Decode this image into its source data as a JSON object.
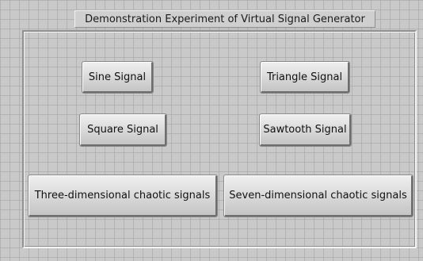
{
  "window": {
    "title": "Demonstration Experiment of Virtual Signal Generator"
  },
  "buttons": {
    "sine": "Sine Signal",
    "triangle": "Triangle Signal",
    "square": "Square Signal",
    "sawtooth": "Sawtooth Signal",
    "three_dimensional": "Three-dimensional chaotic signals",
    "seven_dimensional": "Seven-dimensional chaotic signals"
  },
  "colors": {
    "panel_background": "#c9c9c9",
    "grid_line": "#a0a0a0",
    "button_face": "#dcdcdc",
    "text": "#111111"
  }
}
